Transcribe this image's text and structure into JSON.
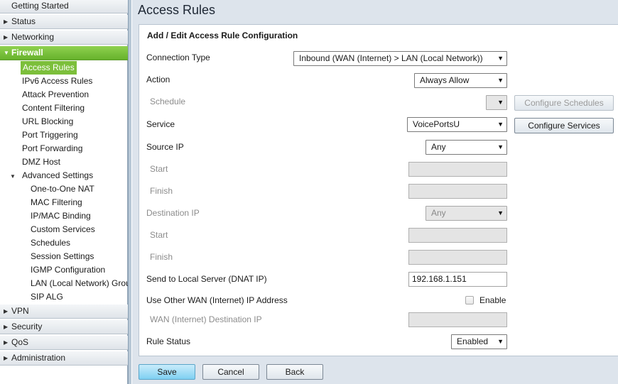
{
  "sidebar": {
    "getting_started": "Getting Started",
    "status": "Status",
    "networking": "Networking",
    "firewall": "Firewall",
    "firewall_items": [
      "Access Rules",
      "IPv6 Access Rules",
      "Attack Prevention",
      "Content Filtering",
      "URL Blocking",
      "Port Triggering",
      "Port Forwarding",
      "DMZ Host"
    ],
    "advanced_settings": "Advanced Settings",
    "advanced_items": [
      "One-to-One NAT",
      "MAC Filtering",
      "IP/MAC Binding",
      "Custom Services",
      "Schedules",
      "Session Settings",
      "IGMP Configuration",
      "LAN (Local Network) Grou",
      "SIP ALG"
    ],
    "vpn": "VPN",
    "security": "Security",
    "qos": "QoS",
    "administration": "Administration"
  },
  "page": {
    "title": "Access Rules",
    "panel_title": "Add / Edit Access Rule Configuration"
  },
  "form": {
    "connection_type_label": "Connection Type",
    "connection_type_value": "Inbound (WAN (Internet) > LAN (Local Network))",
    "action_label": "Action",
    "action_value": "Always Allow",
    "schedule_label": "Schedule",
    "schedule_value": "",
    "configure_schedules": "Configure Schedules",
    "service_label": "Service",
    "service_value": "VoicePortsU",
    "configure_services": "Configure Services",
    "source_ip_label": "Source IP",
    "source_ip_value": "Any",
    "start_label": "Start",
    "finish_label": "Finish",
    "destination_ip_label": "Destination IP",
    "destination_ip_value": "Any",
    "dnat_label": "Send to Local Server (DNAT IP)",
    "dnat_value": "192.168.1.151",
    "other_wan_label": "Use Other WAN (Internet) IP Address",
    "enable_label": "Enable",
    "wan_dest_label": "WAN (Internet) Destination IP",
    "rule_status_label": "Rule Status",
    "rule_status_value": "Enabled"
  },
  "footer": {
    "save": "Save",
    "cancel": "Cancel",
    "back": "Back"
  },
  "colors": {
    "accent_green": "#7cbf3b",
    "save_blue": "#7fd0f2",
    "main_bg": "#dde4ec"
  }
}
